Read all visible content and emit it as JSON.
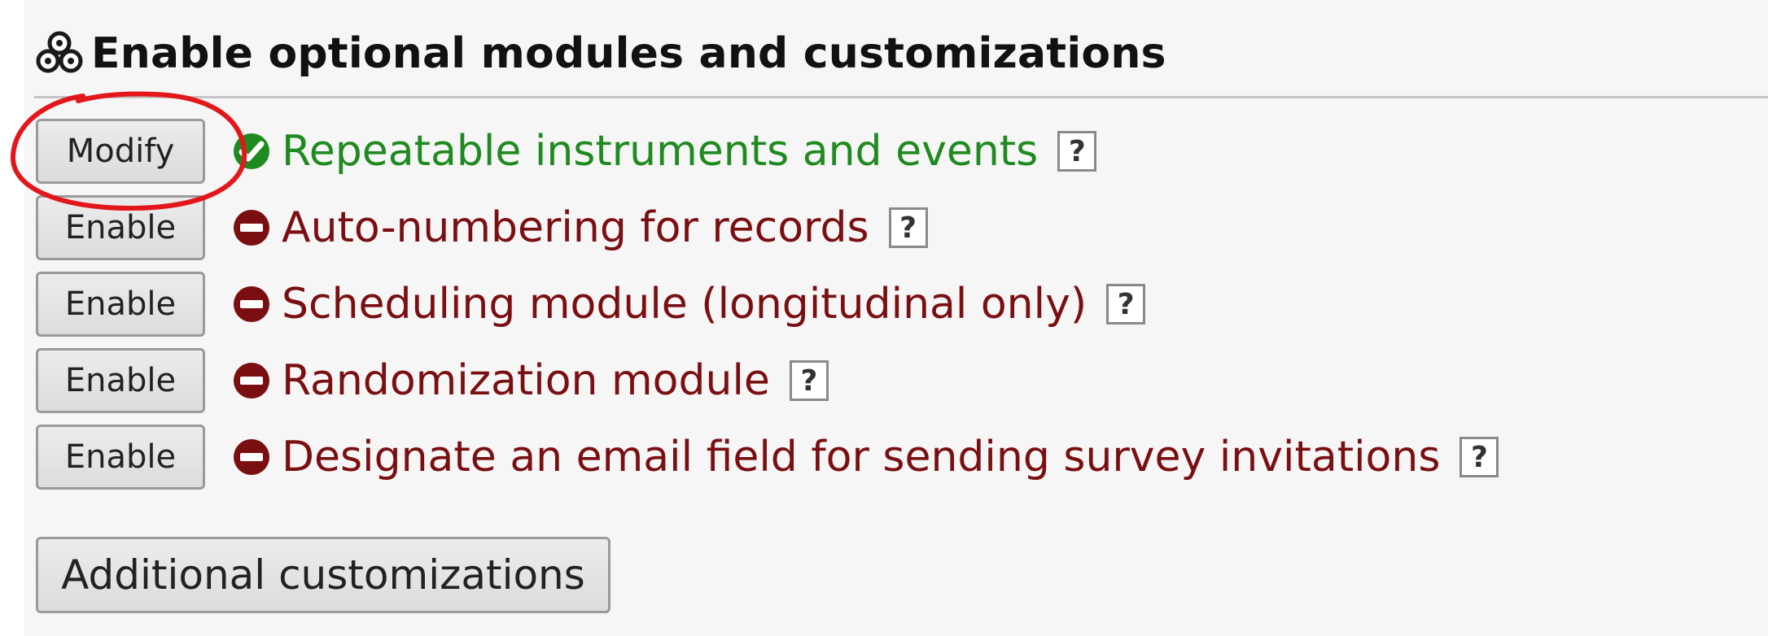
{
  "section": {
    "title": "Enable optional modules and customizations",
    "icon": "modules-icon"
  },
  "modules": [
    {
      "button_label": "Modify",
      "status": "enabled",
      "status_icon": "check-circle-icon",
      "label": "Repeatable instruments and events",
      "help": "?"
    },
    {
      "button_label": "Enable",
      "status": "disabled",
      "status_icon": "minus-circle-icon",
      "label": "Auto-numbering for records",
      "help": "?"
    },
    {
      "button_label": "Enable",
      "status": "disabled",
      "status_icon": "minus-circle-icon",
      "label": "Scheduling module (longitudinal only)",
      "help": "?"
    },
    {
      "button_label": "Enable",
      "status": "disabled",
      "status_icon": "minus-circle-icon",
      "label": "Randomization module",
      "help": "?"
    },
    {
      "button_label": "Enable",
      "status": "disabled",
      "status_icon": "minus-circle-icon",
      "label": "Designate an email field for sending survey invitations",
      "help": "?"
    }
  ],
  "additional_button_label": "Additional customizations",
  "colors": {
    "enabled": "#1f8a1f",
    "disabled": "#7a0f12",
    "annotation": "#e3171b"
  }
}
